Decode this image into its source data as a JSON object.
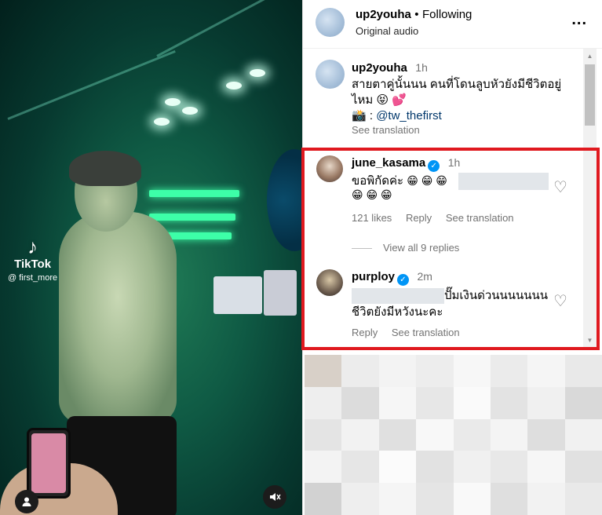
{
  "video": {
    "watermark_name": "TikTok",
    "watermark_handle": "@ first_more"
  },
  "post": {
    "author": "up2youha",
    "separator": "•",
    "follow_status": "Following",
    "audio": "Original audio",
    "more_label": "..."
  },
  "caption": {
    "author": "up2youha",
    "time": "1h",
    "text_line1": "สายตาคู่นั้นนน คนที่โดนลูบหัวยังมีชีวิตอยู่",
    "text_line2": "ไหม 😝 💕",
    "credit_prefix": "📸 : ",
    "credit_handle": "@tw_thefirst",
    "see_translation": "See translation"
  },
  "comments": [
    {
      "author": "june_kasama",
      "verified": true,
      "time": "1h",
      "text_start": "ขอพิกัดค่ะ",
      "emojis_line1": "😁 😁 😁",
      "emojis_line2": "😁 😁 😁",
      "likes": "121 likes",
      "reply": "Reply",
      "see_translation": "See translation",
      "view_replies": "View all 9 replies"
    },
    {
      "author": "purploy",
      "verified": true,
      "time": "2m",
      "text_line1": "ปั๊มเงินด่วนนนนนนน",
      "text_line2": "ชีวิตยังมีหวังนะคะ",
      "reply": "Reply",
      "see_translation": "See translation"
    }
  ],
  "icons": {
    "verified": "verified-badge-icon",
    "heart": "heart-outline-icon",
    "mute": "muted-speaker-icon",
    "user": "user-tag-icon"
  },
  "colors": {
    "highlight_border": "#e0191f",
    "verified_blue": "#0095f6",
    "link": "#00376b",
    "muted_text": "#737373"
  }
}
